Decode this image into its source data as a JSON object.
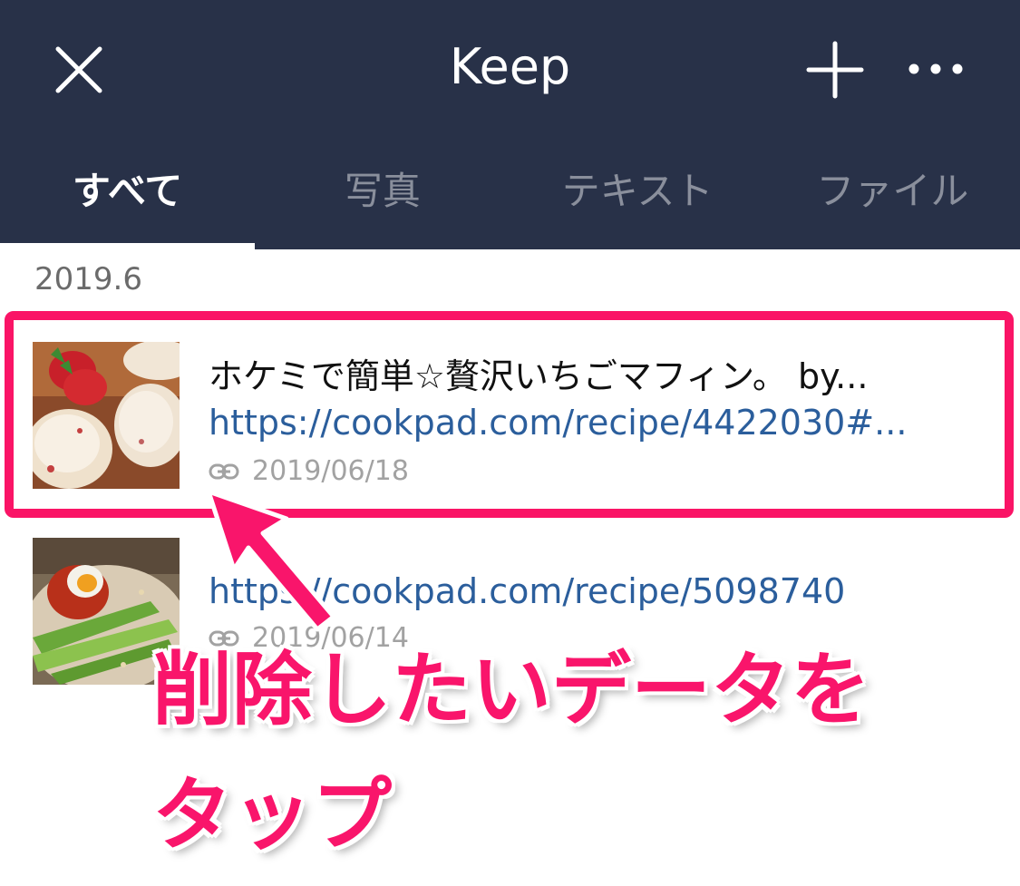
{
  "header": {
    "title": "Keep",
    "close_icon": "close-icon",
    "add_icon": "plus-icon",
    "more_icon": "more-dots-icon"
  },
  "tabs": [
    {
      "label": "すべて",
      "active": true
    },
    {
      "label": "写真",
      "active": false
    },
    {
      "label": "テキスト",
      "active": false
    },
    {
      "label": "ファイル",
      "active": false
    }
  ],
  "section": {
    "label": "2019.6"
  },
  "items": [
    {
      "title": "ホケミで簡単☆贅沢いちごマフィン。 by...",
      "link": "https://cookpad.com/recipe/4422030#...",
      "date": "2019/06/18",
      "thumb_icon": "muffin-photo",
      "meta_icon": "link-icon"
    },
    {
      "title": "",
      "link": "https://cookpad.com/recipe/5098740",
      "date": "2019/06/14",
      "thumb_icon": "noodle-photo",
      "meta_icon": "link-icon"
    }
  ],
  "annotation": {
    "line1": "削除したいデータを",
    "line2": "タップ"
  },
  "colors": {
    "header_bg": "#283148",
    "accent": "#f9156b",
    "link": "#2b5e9c"
  }
}
